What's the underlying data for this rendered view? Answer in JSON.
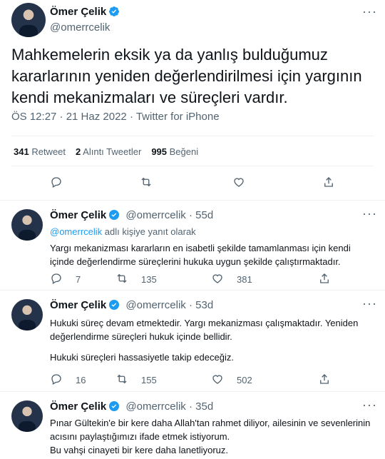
{
  "main_tweet": {
    "author_name": "Ömer Çelik",
    "author_handle": "@omerrcelik",
    "text": "Mahkemelerin eksik ya da yanlış bulduğumuz kararlarının yeniden değerlendirilmesi için yargının kendi mekanizmaları ve süreçleri vardır.",
    "meta": "ÖS 12:27 · 21 Haz 2022 · Twitter for iPhone",
    "stats": {
      "retweets_count": "341",
      "retweets_label": "Retweet",
      "quotes_count": "2",
      "quotes_label": "Alıntı Tweetler",
      "likes_count": "995",
      "likes_label": "Beğeni"
    }
  },
  "replies": [
    {
      "author_name": "Ömer Çelik",
      "author_handle": "@omerrcelik",
      "time": "55d",
      "reply_to_handle": "@omerrcelik",
      "reply_to_suffix": "adlı kişiye yanıt olarak",
      "text": "Yargı mekanizması kararların en isabetli şekilde tamamlanması için kendi içinde değerlendirme süreçlerini hukuka uygun şekilde çalıştırmaktadır.",
      "replies": "7",
      "retweets": "135",
      "likes": "381"
    },
    {
      "author_name": "Ömer Çelik",
      "author_handle": "@omerrcelik",
      "time": "53d",
      "text": "Hukuki süreç devam etmektedir. Yargı mekanizması çalışmaktadır. Yeniden değerlendirme süreçleri hukuk içinde bellidir.",
      "text2": "Hukuki süreçleri hassasiyetle takip edeceğiz.",
      "replies": "16",
      "retweets": "155",
      "likes": "502"
    },
    {
      "author_name": "Ömer Çelik",
      "author_handle": "@omerrcelik",
      "time": "35d",
      "text": "Pınar Gültekin'e bir kere daha Allah'tan rahmet diliyor, ailesinin ve sevenlerinin acısını paylaştığımızı ifade etmek istiyorum.",
      "text2": "Bu vahşi cinayeti bir kere daha lanetliyoruz."
    }
  ],
  "colors": {
    "accent": "#1d9bf0",
    "text": "#0f1419",
    "muted": "#536471"
  }
}
